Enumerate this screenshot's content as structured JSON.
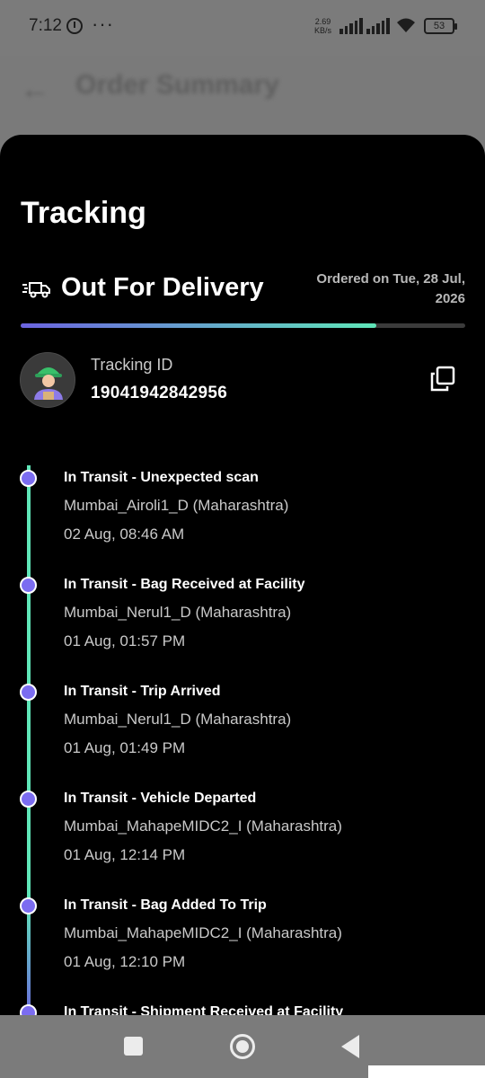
{
  "status_bar": {
    "time": "7:12",
    "dots": "···",
    "speed_value": "2.69",
    "speed_unit": "KB/s",
    "battery": "53"
  },
  "background_header": {
    "back_icon": "←",
    "title": "Order Summary"
  },
  "tracking": {
    "title": "Tracking",
    "status": "Out For Delivery",
    "status_icon": "truck-icon",
    "ordered_on": "Ordered on Tue, 28 Jul, 2026",
    "progress": 0.8,
    "tracking_id_label": "Tracking ID",
    "tracking_id": "19041942842956",
    "colors": {
      "accent_purple": "#7b6cf0",
      "accent_green": "#5fe6b8"
    }
  },
  "events": [
    {
      "title": "In Transit - Unexpected scan",
      "location": "Mumbai_Airoli1_D (Maharashtra)",
      "time": "02 Aug, 08:46 AM"
    },
    {
      "title": "In Transit - Bag Received at Facility",
      "location": "Mumbai_Nerul1_D (Maharashtra)",
      "time": "01 Aug, 01:57 PM"
    },
    {
      "title": "In Transit - Trip Arrived",
      "location": "Mumbai_Nerul1_D (Maharashtra)",
      "time": "01 Aug, 01:49 PM"
    },
    {
      "title": "In Transit - Vehicle Departed",
      "location": "Mumbai_MahapeMIDC2_I (Maharashtra)",
      "time": "01 Aug, 12:14 PM"
    },
    {
      "title": "In Transit - Bag Added To Trip",
      "location": "Mumbai_MahapeMIDC2_I (Maharashtra)",
      "time": "01 Aug, 12:10 PM"
    },
    {
      "title": "In Transit - Shipment Received at Facility",
      "location": "",
      "time": ""
    }
  ]
}
